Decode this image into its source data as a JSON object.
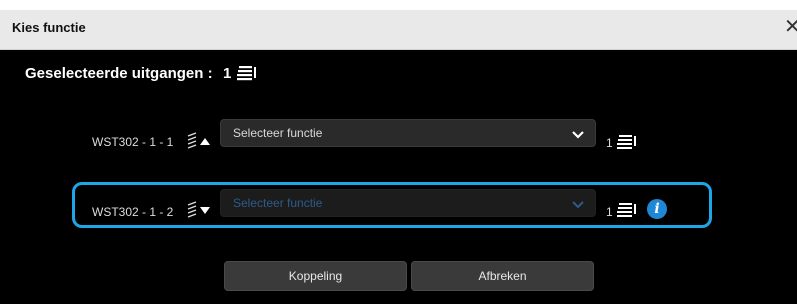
{
  "dialog": {
    "title": "Kies functie",
    "close_glyph": "✕"
  },
  "selected": {
    "label": "Geselecteerde uitgangen :",
    "count": "1",
    "icon": "stack-icon"
  },
  "rows": [
    {
      "label": "WST302 - 1 - 1",
      "sort_direction": "up",
      "select_placeholder": "Selecteer functie",
      "count": "1",
      "enabled": true
    },
    {
      "label": "WST302 - 1 - 2",
      "sort_direction": "down",
      "select_placeholder": "Selecteer functie",
      "count": "1",
      "enabled": false,
      "highlighted": true,
      "info_glyph": "i"
    }
  ],
  "buttons": {
    "connect": "Koppeling",
    "cancel": "Afbreken"
  },
  "colors": {
    "background": "#000000",
    "highlight": "#1ea7e6",
    "info": "#1e88d6"
  }
}
